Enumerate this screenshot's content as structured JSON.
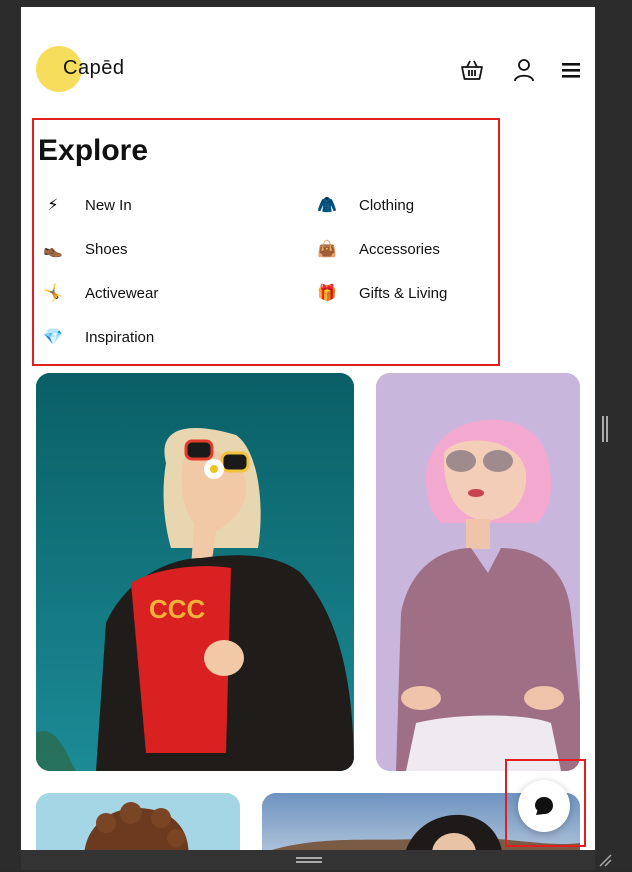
{
  "brand": {
    "logo_text": "Capēd",
    "logo_color": "#f7dd5c"
  },
  "header": {
    "icons": [
      "basket-icon",
      "user-icon",
      "menu-icon"
    ]
  },
  "explore": {
    "title": "Explore",
    "items": [
      {
        "label": "New In",
        "icon": "lightning-icon",
        "emoji": "⚡"
      },
      {
        "label": "Clothing",
        "icon": "coat-icon",
        "emoji": "🧥"
      },
      {
        "label": "Shoes",
        "icon": "shoe-icon",
        "emoji": "👞"
      },
      {
        "label": "Accessories",
        "icon": "handbag-icon",
        "emoji": "👜"
      },
      {
        "label": "Activewear",
        "icon": "gymnast-icon",
        "emoji": "🤸"
      },
      {
        "label": "Gifts & Living",
        "icon": "gift-icon",
        "emoji": "🎁"
      },
      {
        "label": "Inspiration",
        "icon": "gem-icon",
        "emoji": "💎"
      }
    ],
    "highlight_color": "#e02020"
  },
  "products": [
    {
      "image": "woman-sunglasses-red-shirt-photo",
      "color": "#0e6c72"
    },
    {
      "image": "woman-pink-hair-sweater-photo",
      "color": "#c7b4da"
    },
    {
      "image": "curly-hair-person-photo",
      "color": "#9fd2e4"
    },
    {
      "image": "woman-outdoor-photo",
      "color": "#8aa6c4"
    }
  ],
  "chat": {
    "icon": "chat-bubble-icon"
  }
}
